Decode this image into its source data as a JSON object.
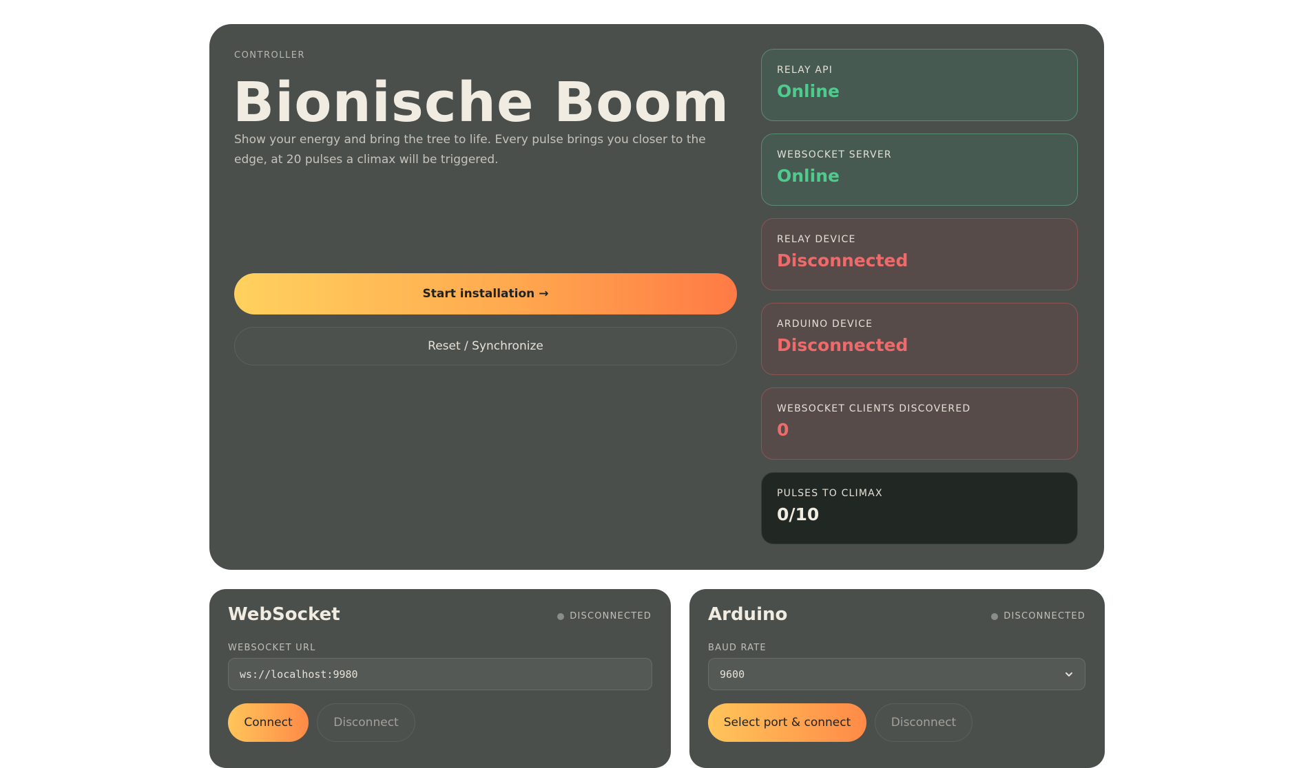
{
  "controller": {
    "eyebrow": "CONTROLLER",
    "title": "Bionische Boom",
    "description": "Show your energy and bring the tree to life. Every pulse brings you closer to the edge, at 20 pulses a climax will be triggered.",
    "start_label": "Start installation",
    "start_arrow": "→",
    "reset_label": "Reset / Synchronize"
  },
  "statuses": [
    {
      "label": "RELAY API",
      "value": "Online",
      "state": "ok"
    },
    {
      "label": "WEBSOCKET SERVER",
      "value": "Online",
      "state": "ok"
    },
    {
      "label": "RELAY DEVICE",
      "value": "Disconnected",
      "state": "bad"
    },
    {
      "label": "ARDUINO DEVICE",
      "value": "Disconnected",
      "state": "bad"
    },
    {
      "label": "WEBSOCKET CLIENTS DISCOVERED",
      "value": "0",
      "state": "bad"
    },
    {
      "label": "PULSES TO CLIMAX",
      "value": "0/10",
      "state": "dark"
    }
  ],
  "websocket": {
    "title": "WebSocket",
    "status": "DISCONNECTED",
    "field_label": "WEBSOCKET URL",
    "url": "ws://localhost:9980",
    "connect_label": "Connect",
    "disconnect_label": "Disconnect"
  },
  "arduino": {
    "title": "Arduino",
    "status": "DISCONNECTED",
    "field_label": "BAUD RATE",
    "baud_rate": "9600",
    "connect_label": "Select port & connect",
    "disconnect_label": "Disconnect"
  },
  "colors": {
    "online": "#4ecb8d",
    "disconnected": "#ef6b6b",
    "accent_start": "#ffd15e",
    "accent_end": "#ff7a45"
  }
}
